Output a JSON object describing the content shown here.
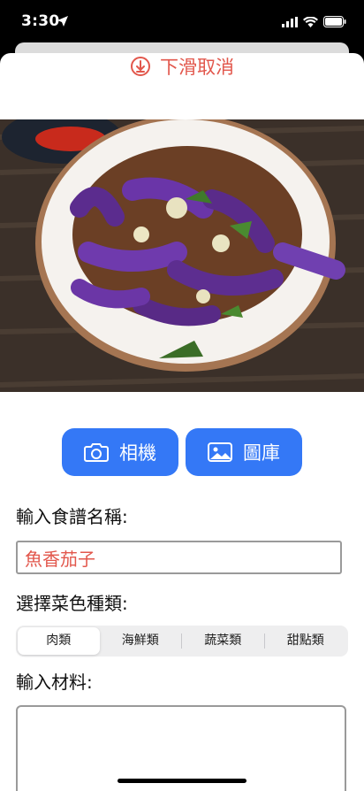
{
  "status_bar": {
    "time": "3:30"
  },
  "sheet": {
    "dismiss_label": "下滑取消",
    "buttons": {
      "camera": "相機",
      "gallery": "圖庫"
    },
    "recipe_name_label": "輸入食譜名稱:",
    "recipe_name_value": "魚香茄子",
    "category_label": "選擇菜色種類:",
    "categories": [
      "肉類",
      "海鮮類",
      "蔬菜類",
      "甜點類"
    ],
    "selected_category": "肉類",
    "ingredients_label": "輸入材料:"
  },
  "colors": {
    "accent_red": "#e2574c",
    "button_blue": "#3478f6"
  }
}
